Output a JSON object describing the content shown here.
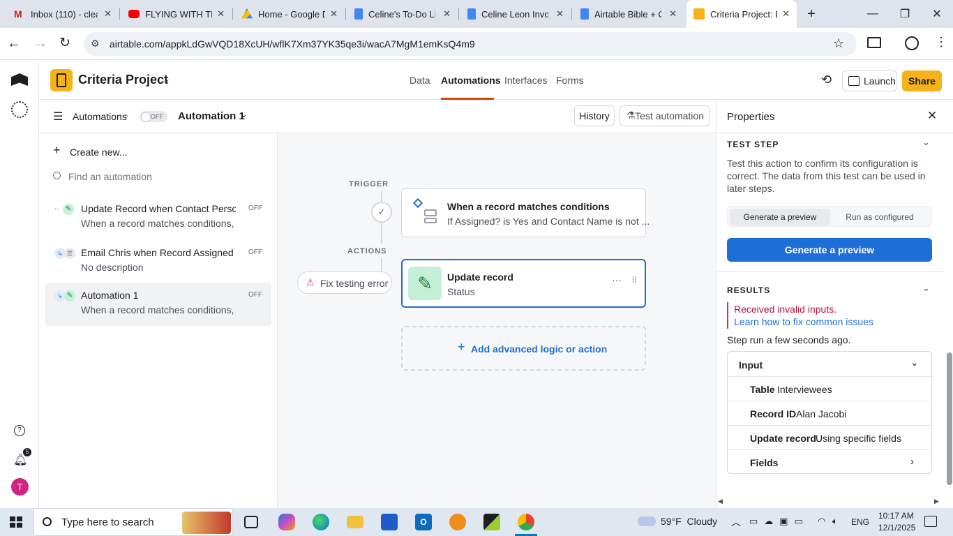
{
  "browser": {
    "tabs": [
      {
        "title": "Inbox (110) - clea",
        "icon_color": "#c5221f"
      },
      {
        "title": "FLYING WITH THE",
        "icon_color": "#ff0000"
      },
      {
        "title": "Home - Google D",
        "icon_color": "#1e8e3e"
      },
      {
        "title": "Celine's To-Do Li",
        "icon_color": "#4285f4"
      },
      {
        "title": "Celine Leon Invo",
        "icon_color": "#4285f4"
      },
      {
        "title": "Airtable Bible + C",
        "icon_color": "#4285f4"
      },
      {
        "title": "Criteria Project: D",
        "icon_color": "#f7b21a",
        "active": true
      }
    ],
    "url": "airtable.com/appkLdGwVQD18XcUH/wflK7Xm37YK35qe3i/wacA7MgM1emKsQ4m9"
  },
  "header": {
    "base_name": "Criteria Project",
    "nav_tabs": [
      "Data",
      "Automations",
      "Interfaces",
      "Forms"
    ],
    "active_tab": "Automations",
    "launch_label": "Launch",
    "share_label": "Share",
    "accent_color": "#f7b21a"
  },
  "subbar": {
    "breadcrumb_root": "Automations",
    "toggle_label": "OFF",
    "automation_name": "Automation 1",
    "history_label": "History",
    "test_label": "Test automation"
  },
  "sidebar": {
    "create_label": "Create new...",
    "search_placeholder": "Find an automation",
    "items": [
      {
        "title": "Update Record when Contact Person...",
        "desc": "When a record matches conditions, f...",
        "badge": "OFF"
      },
      {
        "title": "Email Chris when Record Assigned C...",
        "desc": "No description",
        "badge": "OFF"
      },
      {
        "title": "Automation 1",
        "desc": "When a record matches conditions, ...",
        "badge": "OFF",
        "active": true
      }
    ],
    "notification_count": "5",
    "avatar_letter": "T"
  },
  "canvas": {
    "trigger_label": "TRIGGER",
    "trigger_title": "When a record matches conditions",
    "trigger_sub": "If Assigned? is Yes and Contact Name is not ...",
    "actions_label": "ACTIONS",
    "fix_label": "Fix testing error",
    "action_title": "Update record",
    "action_sub": "Status",
    "add_label": "Add advanced logic or action",
    "error_color": "#d5303e",
    "action_border_color": "#1e6ed8",
    "action_icon_bg": "#c5f0d7"
  },
  "properties": {
    "title": "Properties",
    "test_step_label": "TEST STEP",
    "test_step_desc": "Test this action to confirm its configuration is correct. The data from this test can be used in later steps.",
    "seg_options": [
      "Generate a preview",
      "Run as configured"
    ],
    "primary_label": "Generate a preview",
    "results_label": "RESULTS",
    "error_text": "Received invalid inputs.",
    "help_link": "Learn how to fix common issues",
    "step_run": "Step run a few seconds ago.",
    "input_label": "Input",
    "rows": [
      {
        "key": "Table",
        "value": "Interviewees"
      },
      {
        "key": "Record ID",
        "value": "Alan Jacobi"
      },
      {
        "key": "Update record",
        "value": "Using specific fields"
      },
      {
        "key": "Fields",
        "value": ""
      }
    ]
  },
  "taskbar": {
    "search_placeholder": "Type here to search",
    "weather": "59°F  Cloudy",
    "lang": "ENG",
    "time": "10:17 AM",
    "date": "12/1/2025"
  }
}
